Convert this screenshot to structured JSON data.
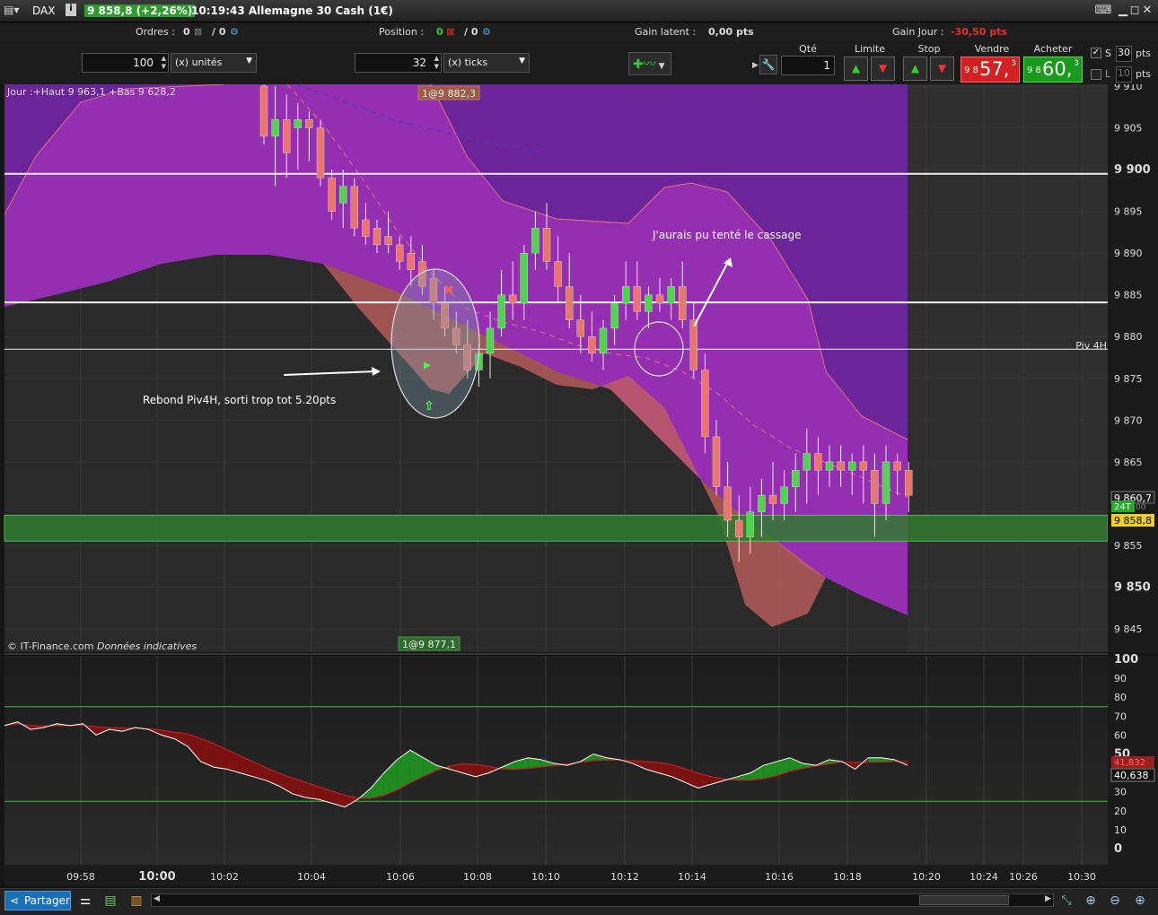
{
  "title_bar": {
    "symbol": "DAX",
    "info_icon": "i",
    "quote": "9 858,8 (+2,26%)",
    "time_title": "10:19:43 Allemagne 30 Cash (1€)"
  },
  "info_bar": {
    "orders_label": "Ordres :",
    "orders_count": "0",
    "orders_slash": "/ 0",
    "position_label": "Position :",
    "position_count": "0",
    "position_slash": "/ 0",
    "latent_label": "Gain latent :",
    "latent_value": "0,00 pts",
    "day_gain_label": "Gain Jour :",
    "day_gain_value": "-30,50 pts"
  },
  "controls": {
    "qty_units_value": "100",
    "qty_units_select": "(x) unités",
    "ticks_value": "32",
    "ticks_select": "(x) ticks",
    "qte_header": "Qté",
    "qte_value": "1",
    "limite_header": "Limite",
    "stop_header": "Stop",
    "sell_header": "Vendre",
    "buy_header": "Acheter",
    "sell_small": "9 8",
    "sell_big": "57,",
    "sell_sup": "3",
    "buy_small": "9 8",
    "buy_big": "60,",
    "buy_sup": "3",
    "s_label": "S",
    "s_value": "30",
    "s_unit": "pts",
    "l_label": "L",
    "l_value": "10",
    "l_unit": "pts"
  },
  "chart": {
    "day_info": "Jour :+Haut 9 963,1 +Bas 9 628,2",
    "tag_top": "1@9 882,3",
    "tag_bottom": "1@9 877,1",
    "copyright": "© IT-Finance.com",
    "copyright_italic": "Données indicatives",
    "annotation_1": "Rebond Piv4H, sorti trop tot 5.20pts",
    "annotation_2": "J'aurais pu tenté le cassage",
    "piv_label": "Piv 4H",
    "price_ticks": [
      "9 910",
      "9 905",
      "9 900",
      "9 895",
      "9 890",
      "9 885",
      "9 880",
      "9 875",
      "9 870",
      "9 865",
      "9 860,7",
      "9 855",
      "9 850",
      "9 845"
    ],
    "badge_24t": "24T",
    "badge_small": "00",
    "last_price_badge": "9 858,8",
    "osc_ticks": [
      "100",
      "90",
      "80",
      "70",
      "60",
      "50",
      "40",
      "30",
      "20",
      "10",
      "0"
    ],
    "osc_badge_red": "41,832",
    "osc_badge_value": "40,638",
    "time_labels": [
      "09:58",
      "10:00",
      "10:02",
      "10:04",
      "10:06",
      "10:08",
      "10:10",
      "10:12",
      "10:14",
      "10:16",
      "10:18",
      "10:20",
      "10:24",
      "10:26",
      "10:30"
    ]
  },
  "chart_data": {
    "type": "candlestick",
    "yrange": [
      9843,
      9911
    ],
    "horizontal_lines": [
      9899.5,
      9884.1,
      9878.5
    ],
    "support_zone": [
      9855.5,
      9858.6
    ],
    "candles": [
      {
        "o": 9910,
        "h": 9911,
        "l": 9903,
        "c": 9904
      },
      {
        "o": 9904,
        "h": 9910,
        "l": 9898,
        "c": 9906
      },
      {
        "o": 9906,
        "h": 9909,
        "l": 9899,
        "c": 9902
      },
      {
        "o": 9905,
        "h": 9908,
        "l": 9900,
        "c": 9906
      },
      {
        "o": 9906,
        "h": 9907,
        "l": 9901,
        "c": 9905
      },
      {
        "o": 9905,
        "h": 9906,
        "l": 9898,
        "c": 9899
      },
      {
        "o": 9899,
        "h": 9900,
        "l": 9894,
        "c": 9895
      },
      {
        "o": 9896,
        "h": 9900,
        "l": 9893,
        "c": 9898
      },
      {
        "o": 9898,
        "h": 9899,
        "l": 9892,
        "c": 9893
      },
      {
        "o": 9894,
        "h": 9896,
        "l": 9891,
        "c": 9892
      },
      {
        "o": 9893,
        "h": 9894,
        "l": 9890,
        "c": 9891
      },
      {
        "o": 9892,
        "h": 9895,
        "l": 9890,
        "c": 9891
      },
      {
        "o": 9891,
        "h": 9892,
        "l": 9888,
        "c": 9889
      },
      {
        "o": 9890,
        "h": 9892,
        "l": 9886,
        "c": 9888
      },
      {
        "o": 9889,
        "h": 9891,
        "l": 9885,
        "c": 9886
      },
      {
        "o": 9887,
        "h": 9888,
        "l": 9882,
        "c": 9884
      },
      {
        "o": 9884,
        "h": 9886,
        "l": 9880,
        "c": 9881
      },
      {
        "o": 9881,
        "h": 9883,
        "l": 9878,
        "c": 9879
      },
      {
        "o": 9879,
        "h": 9882,
        "l": 9875,
        "c": 9876
      },
      {
        "o": 9876,
        "h": 9879,
        "l": 9874,
        "c": 9878
      },
      {
        "o": 9878,
        "h": 9883,
        "l": 9875,
        "c": 9881
      },
      {
        "o": 9881,
        "h": 9888,
        "l": 9880,
        "c": 9885
      },
      {
        "o": 9885,
        "h": 9889,
        "l": 9882,
        "c": 9884
      },
      {
        "o": 9884,
        "h": 9891,
        "l": 9882,
        "c": 9890
      },
      {
        "o": 9890,
        "h": 9895,
        "l": 9888,
        "c": 9893
      },
      {
        "o": 9893,
        "h": 9896,
        "l": 9888,
        "c": 9889
      },
      {
        "o": 9889,
        "h": 9892,
        "l": 9884,
        "c": 9886
      },
      {
        "o": 9886,
        "h": 9890,
        "l": 9881,
        "c": 9882
      },
      {
        "o": 9882,
        "h": 9885,
        "l": 9878,
        "c": 9880
      },
      {
        "o": 9880,
        "h": 9883,
        "l": 9877,
        "c": 9878
      },
      {
        "o": 9878,
        "h": 9882,
        "l": 9876,
        "c": 9881
      },
      {
        "o": 9881,
        "h": 9885,
        "l": 9879,
        "c": 9884
      },
      {
        "o": 9884,
        "h": 9889,
        "l": 9882,
        "c": 9886
      },
      {
        "o": 9886,
        "h": 9889,
        "l": 9882,
        "c": 9883
      },
      {
        "o": 9883,
        "h": 9886,
        "l": 9881,
        "c": 9885
      },
      {
        "o": 9885,
        "h": 9887,
        "l": 9883,
        "c": 9884
      },
      {
        "o": 9884,
        "h": 9887,
        "l": 9882,
        "c": 9886
      },
      {
        "o": 9886,
        "h": 9889,
        "l": 9881,
        "c": 9882
      },
      {
        "o": 9882,
        "h": 9884,
        "l": 9875,
        "c": 9876
      },
      {
        "o": 9876,
        "h": 9878,
        "l": 9866,
        "c": 9868
      },
      {
        "o": 9868,
        "h": 9870,
        "l": 9861,
        "c": 9862
      },
      {
        "o": 9862,
        "h": 9865,
        "l": 9856,
        "c": 9858
      },
      {
        "o": 9858,
        "h": 9861,
        "l": 9853,
        "c": 9856
      },
      {
        "o": 9856,
        "h": 9862,
        "l": 9854,
        "c": 9859
      },
      {
        "o": 9859,
        "h": 9863,
        "l": 9856,
        "c": 9861
      },
      {
        "o": 9861,
        "h": 9865,
        "l": 9858,
        "c": 9860
      },
      {
        "o": 9860,
        "h": 9864,
        "l": 9858,
        "c": 9862
      },
      {
        "o": 9862,
        "h": 9866,
        "l": 9859,
        "c": 9864
      },
      {
        "o": 9864,
        "h": 9869,
        "l": 9860,
        "c": 9866
      },
      {
        "o": 9866,
        "h": 9868,
        "l": 9861,
        "c": 9864
      },
      {
        "o": 9864,
        "h": 9867,
        "l": 9862,
        "c": 9865
      },
      {
        "o": 9865,
        "h": 9867,
        "l": 9862,
        "c": 9864
      },
      {
        "o": 9864,
        "h": 9866,
        "l": 9861,
        "c": 9865
      },
      {
        "o": 9865,
        "h": 9867,
        "l": 9860,
        "c": 9864
      },
      {
        "o": 9864,
        "h": 9866,
        "l": 9856,
        "c": 9860
      },
      {
        "o": 9860,
        "h": 9867,
        "l": 9858,
        "c": 9865
      },
      {
        "o": 9865,
        "h": 9866,
        "l": 9861,
        "c": 9864
      },
      {
        "o": 9864,
        "h": 9865,
        "l": 9859,
        "c": 9861
      }
    ],
    "oscillator": {
      "range": [
        0,
        100
      ],
      "levels": [
        75,
        25
      ],
      "values": [
        65,
        67,
        63,
        64,
        66,
        65,
        66,
        60,
        63,
        62,
        64,
        63,
        60,
        58,
        54,
        46,
        43,
        42,
        40,
        38,
        36,
        33,
        29,
        27,
        26,
        24,
        22,
        26,
        32,
        40,
        47,
        52,
        48,
        44,
        42,
        40,
        38,
        40,
        43,
        46,
        48,
        47,
        45,
        44,
        46,
        50,
        48,
        47,
        45,
        42,
        40,
        38,
        35,
        32,
        34,
        36,
        38,
        40,
        44,
        46,
        48,
        45,
        44,
        47,
        46,
        42,
        48,
        48,
        47,
        44
      ]
    }
  }
}
